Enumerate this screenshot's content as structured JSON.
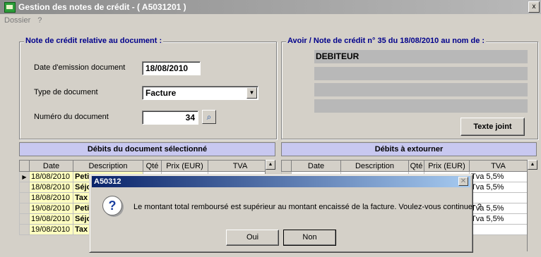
{
  "window": {
    "title": "Gestion des notes de crédit - ( A5031201 )",
    "close": "x"
  },
  "menu": [
    "Dossier",
    "?"
  ],
  "left_group": {
    "title": "Note de crédit relative au document :",
    "date_label": "Date d'emission document",
    "date_value": "18/08/2010",
    "type_label": "Type de document",
    "type_value": "Facture",
    "num_label": "Numéro du document",
    "num_value": "34"
  },
  "right_group": {
    "title": "Avoir / Note de crédit n° 35 du 18/08/2010 au nom de :",
    "name_line": "DEBITEUR",
    "attach_button": "Texte joint"
  },
  "left_table": {
    "header": "Débits du document sélectionné",
    "columns": [
      "Date",
      "Description",
      "Qté",
      "Prix (EUR)",
      "TVA"
    ],
    "rows": [
      {
        "date": "18/08/2010",
        "desc": "Peti",
        "qty": "",
        "price": "",
        "tva": ""
      },
      {
        "date": "18/08/2010",
        "desc": "Séjo",
        "qty": "",
        "price": "",
        "tva": ""
      },
      {
        "date": "18/08/2010",
        "desc": "Tax",
        "qty": "",
        "price": "",
        "tva": ""
      },
      {
        "date": "19/08/2010",
        "desc": "Peti",
        "qty": "",
        "price": "",
        "tva": ""
      },
      {
        "date": "19/08/2010",
        "desc": "Séjo",
        "qty": "",
        "price": "",
        "tva": ""
      },
      {
        "date": "19/08/2010",
        "desc": "Tax",
        "qty": "",
        "price": "",
        "tva": ""
      }
    ]
  },
  "right_table": {
    "header": "Débits à extourner",
    "columns": [
      "Date",
      "Description",
      "Qté",
      "Prix (EUR)",
      "TVA"
    ],
    "tva_values": [
      "Tva 5,5%",
      "Tva 5,5%",
      "",
      "Tva 5,5%",
      "Tva 5,5%",
      ""
    ]
  },
  "dialog": {
    "title": "A50312",
    "message": "Le montant total remboursé  est supérieur au montant encaissé de la facture. Voulez-vous continuer ?",
    "yes": "Oui",
    "no": "Non",
    "icon": "question-icon"
  }
}
